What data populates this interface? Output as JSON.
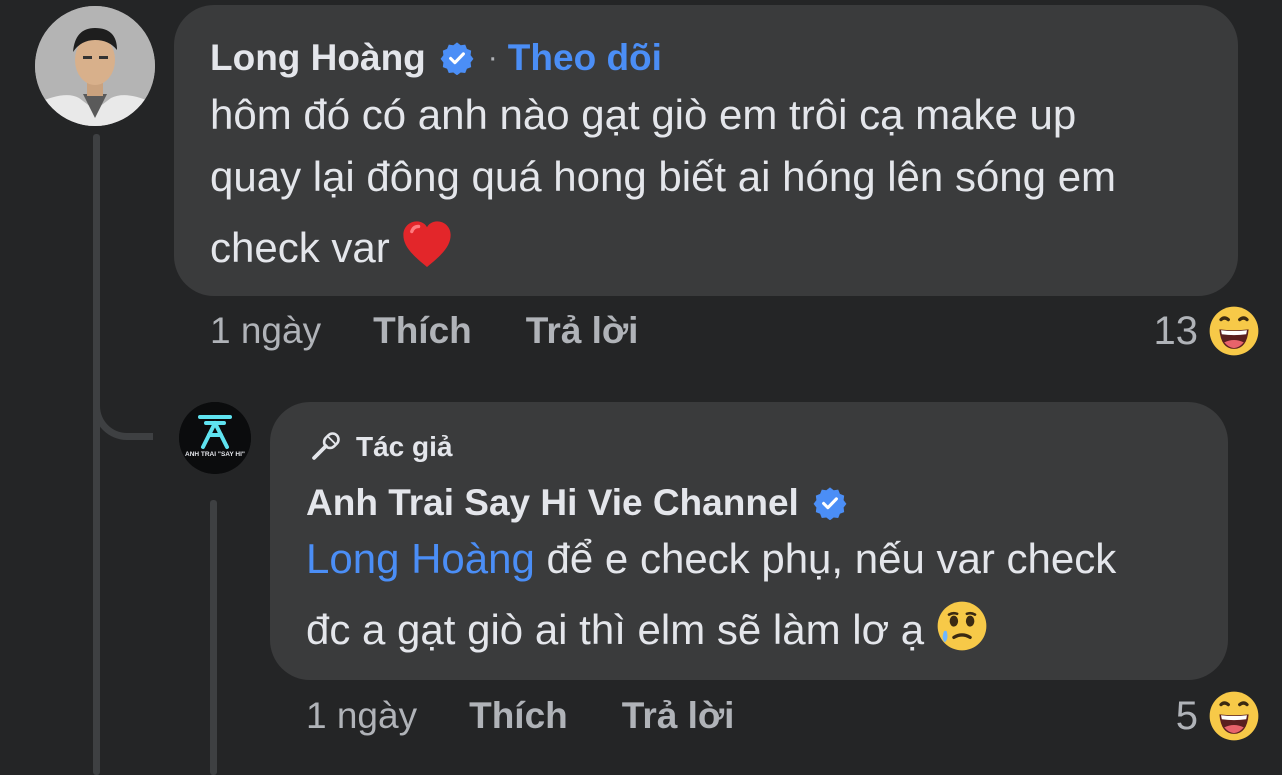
{
  "comment": {
    "author": "Long Hoàng",
    "separator": "·",
    "follow_label": "Theo dõi",
    "text_lines": [
      "hôm đó có anh nào gạt giò em trôi cạ make up",
      "quay lại đông quá hong biết ai hóng lên sóng em",
      "check var"
    ],
    "time": "1 ngày",
    "like_label": "Thích",
    "reply_label": "Trả lời",
    "reaction_count": "13",
    "reaction_icon": "grinning-sweat-emoji",
    "heart_icon": "red-heart-emoji"
  },
  "reply": {
    "badge_label": "Tác giả",
    "author": "Anh Trai Say Hi Vie Channel",
    "mention": "Long Hoàng",
    "text_line1_rest": " để e check phụ, nếu var check",
    "text_line2": "đc a gạt giò ai thì elm sẽ làm lơ ạ",
    "time": "1 ngày",
    "like_label": "Thích",
    "reply_label": "Trả lời",
    "reaction_count": "5",
    "reaction_icon": "grinning-sweat-emoji",
    "tear_icon": "face-holding-back-tears-emoji",
    "avatar_logo_text": "ANH TRAI \"SAY HI\""
  },
  "colors": {
    "background": "#242526",
    "bubble": "#3a3b3c",
    "link_blue": "#4b8ef6",
    "verified_blue": "#4b8ef6",
    "muted": "#b0b3b8"
  }
}
